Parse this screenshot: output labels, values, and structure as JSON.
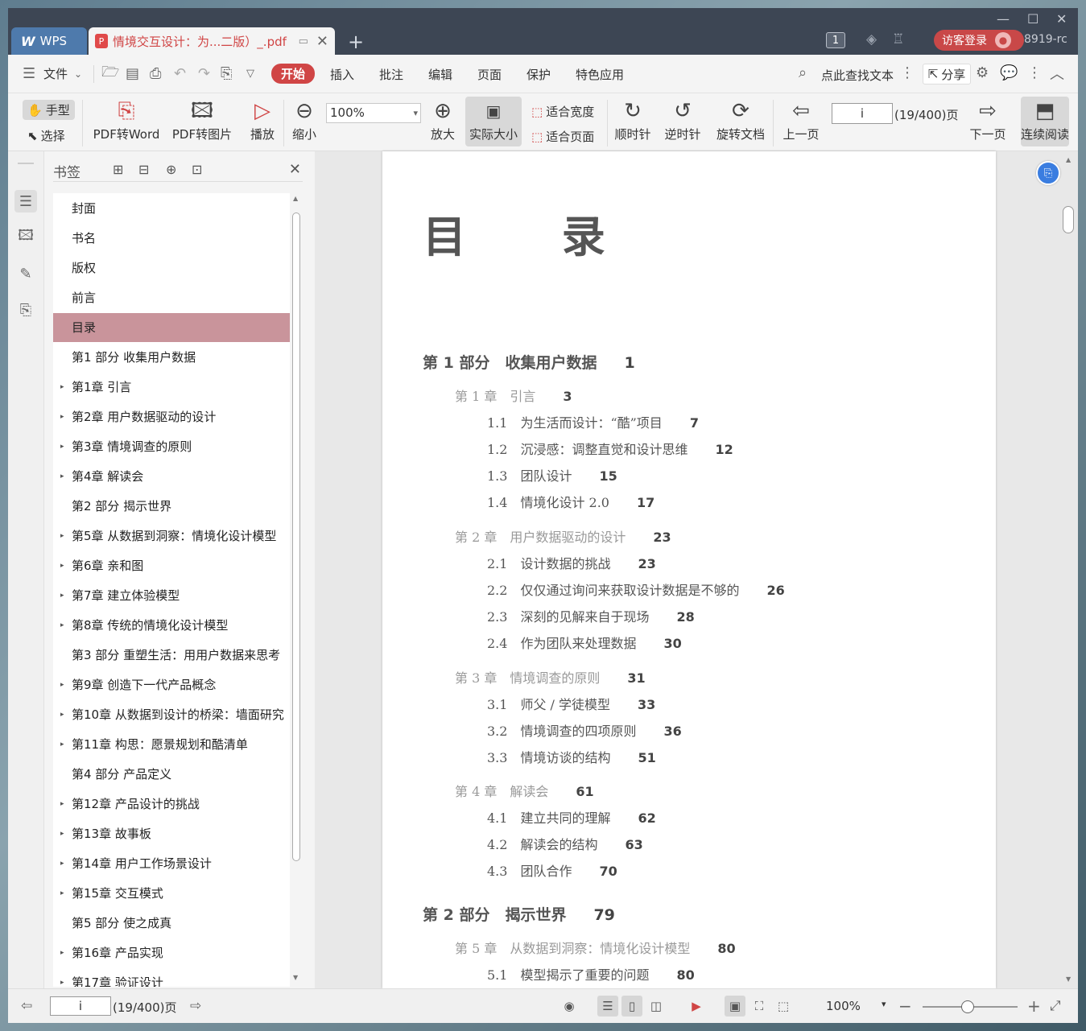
{
  "titlebar": {
    "app_tab": "WPS",
    "doc_tab_title": "情境交互设计：为...二版）_.pdf",
    "window_count": "1",
    "login_label": "访客登录",
    "user_id": "8919-rc"
  },
  "menu": {
    "file": "文件",
    "items": [
      "开始",
      "插入",
      "批注",
      "编辑",
      "页面",
      "保护",
      "特色应用"
    ],
    "search": "点此查找文本",
    "share": "分享"
  },
  "ribbon": {
    "hand": "手型",
    "select": "选择",
    "pdf_to_word": "PDF转Word",
    "pdf_to_image": "PDF转图片",
    "play": "播放",
    "zoom_out": "缩小",
    "zoom_value": "100%",
    "zoom_in": "放大",
    "actual_size": "实际大小",
    "fit_width": "适合宽度",
    "fit_page": "适合页面",
    "clockwise": "顺时针",
    "counterclockwise": "逆时针",
    "rotate_doc": "旋转文档",
    "prev_page": "上一页",
    "page_input": "i",
    "page_count": "(19/400)页",
    "next_page": "下一页",
    "continuous": "连续阅读"
  },
  "bookmarks": {
    "title": "书签",
    "items": [
      {
        "label": "封面",
        "expandable": false
      },
      {
        "label": "书名",
        "expandable": false
      },
      {
        "label": "版权",
        "expandable": false
      },
      {
        "label": "前言",
        "expandable": false
      },
      {
        "label": "目录",
        "expandable": false,
        "selected": true
      },
      {
        "label": "第1 部分 收集用户数据",
        "expandable": false
      },
      {
        "label": "第1章 引言",
        "expandable": true
      },
      {
        "label": "第2章 用户数据驱动的设计",
        "expandable": true
      },
      {
        "label": "第3章 情境调查的原则",
        "expandable": true
      },
      {
        "label": "第4章 解读会",
        "expandable": true
      },
      {
        "label": "第2 部分 揭示世界",
        "expandable": false
      },
      {
        "label": "第5章 从数据到洞察：情境化设计模型",
        "expandable": true
      },
      {
        "label": "第6章 亲和图",
        "expandable": true
      },
      {
        "label": "第7章 建立体验模型",
        "expandable": true
      },
      {
        "label": "第8章 传统的情境化设计模型",
        "expandable": true
      },
      {
        "label": "第3 部分 重塑生活：用用户数据来思考",
        "expandable": false
      },
      {
        "label": "第9章 创造下一代产品概念",
        "expandable": true
      },
      {
        "label": "第10章 从数据到设计的桥梁：墙面研究",
        "expandable": true
      },
      {
        "label": "第11章 构思：愿景规划和酷清单",
        "expandable": true
      },
      {
        "label": "第4 部分 产品定义",
        "expandable": false
      },
      {
        "label": "第12章 产品设计的挑战",
        "expandable": true
      },
      {
        "label": "第13章 故事板",
        "expandable": true
      },
      {
        "label": "第14章 用户工作场景设计",
        "expandable": true
      },
      {
        "label": "第15章 交互模式",
        "expandable": true
      },
      {
        "label": "第5 部分 使之成真",
        "expandable": false
      },
      {
        "label": "第16章 产品实现",
        "expandable": true
      },
      {
        "label": "第17章 验证设计",
        "expandable": true
      }
    ]
  },
  "document": {
    "toc_title": "目 录",
    "entries": [
      {
        "kind": "part",
        "label": "第 1 部分　收集用户数据",
        "page": "1"
      },
      {
        "kind": "chap",
        "label": "第 1 章　引言",
        "page": "3"
      },
      {
        "kind": "sec",
        "label": "1.1　为生活而设计：“酷”项目",
        "page": "7"
      },
      {
        "kind": "sec",
        "label": "1.2　沉浸感：调整直觉和设计思维",
        "page": "12"
      },
      {
        "kind": "sec",
        "label": "1.3　团队设计",
        "page": "15"
      },
      {
        "kind": "sec",
        "label": "1.4　情境化设计 2.0",
        "page": "17"
      },
      {
        "kind": "chap",
        "label": "第 2 章　用户数据驱动的设计",
        "page": "23"
      },
      {
        "kind": "sec",
        "label": "2.1　设计数据的挑战",
        "page": "23"
      },
      {
        "kind": "sec",
        "label": "2.2　仅仅通过询问来获取设计数据是不够的",
        "page": "26"
      },
      {
        "kind": "sec",
        "label": "2.3　深刻的见解来自于现场",
        "page": "28"
      },
      {
        "kind": "sec",
        "label": "2.4　作为团队来处理数据",
        "page": "30"
      },
      {
        "kind": "chap",
        "label": "第 3 章　情境调查的原则",
        "page": "31"
      },
      {
        "kind": "sec",
        "label": "3.1　师父 / 学徒模型",
        "page": "33"
      },
      {
        "kind": "sec",
        "label": "3.2　情境调查的四项原则",
        "page": "36"
      },
      {
        "kind": "sec",
        "label": "3.3　情境访谈的结构",
        "page": "51"
      },
      {
        "kind": "chap",
        "label": "第 4 章　解读会",
        "page": "61"
      },
      {
        "kind": "sec",
        "label": "4.1　建立共同的理解",
        "page": "62"
      },
      {
        "kind": "sec",
        "label": "4.2　解读会的结构",
        "page": "63"
      },
      {
        "kind": "sec",
        "label": "4.3　团队合作",
        "page": "70"
      },
      {
        "kind": "part",
        "label": "第 2 部分　揭示世界",
        "page": "79"
      },
      {
        "kind": "chap",
        "label": "第 5 章　从数据到洞察：情境化设计模型",
        "page": "80"
      },
      {
        "kind": "sec",
        "label": "5.1　模型揭示了重要的问题",
        "page": "80"
      }
    ]
  },
  "status": {
    "page_input": "i",
    "page_count": "(19/400)页",
    "zoom": "100%"
  },
  "colors": {
    "accent": "#d04545",
    "selected_bookmark": "#c9949b",
    "titlebar": "#3d4654"
  }
}
